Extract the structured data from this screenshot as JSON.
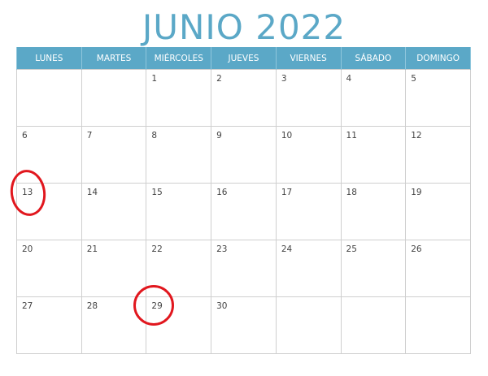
{
  "calendar": {
    "title": "JUNIO 2022",
    "weekdays": [
      "LUNES",
      "MARTES",
      "MIÉRCOLES",
      "JUEVES",
      "VIERNES",
      "SÁBADO",
      "DOMINGO"
    ],
    "weeks": [
      [
        "",
        "",
        "1",
        "2",
        "3",
        "4",
        "5"
      ],
      [
        "6",
        "7",
        "8",
        "9",
        "10",
        "11",
        "12"
      ],
      [
        "13",
        "14",
        "15",
        "16",
        "17",
        "18",
        "19"
      ],
      [
        "20",
        "21",
        "22",
        "23",
        "24",
        "25",
        "26"
      ],
      [
        "27",
        "28",
        "29",
        "30",
        "",
        "",
        ""
      ]
    ],
    "circled_days": [
      "13",
      "29"
    ],
    "colors": {
      "accent": "#5ba8c7",
      "grid": "#cfcfcf",
      "circle": "#e1171e"
    }
  }
}
